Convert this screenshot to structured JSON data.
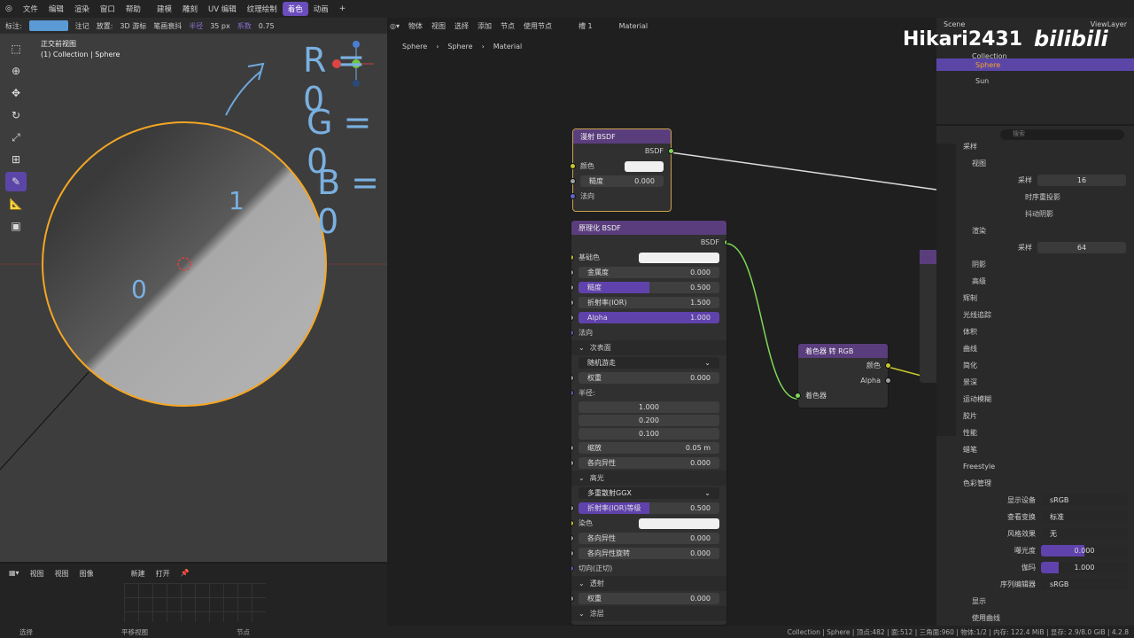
{
  "topmenu": [
    "文件",
    "编辑",
    "渲染",
    "窗口",
    "帮助"
  ],
  "workspaces": [
    "建模",
    "雕刻",
    "UV 编辑",
    "纹理绘制",
    "着色",
    "动画"
  ],
  "active_ws": "着色",
  "viewport": {
    "header_items": [
      "标注:",
      "注记",
      "放置:",
      "3D 游标",
      "笔画衰抖",
      "半径",
      "35 px",
      "系数",
      "0.75"
    ],
    "title": "正交前视图",
    "subtitle": "(1) Collection | Sphere",
    "annotations": [
      "R = 0",
      "G = 0",
      "B = 0",
      "1",
      "0"
    ]
  },
  "node_editor": {
    "header": [
      "物体",
      "视图",
      "选择",
      "添加",
      "节点",
      "使用节点",
      "槽 1",
      "Material"
    ],
    "breadcrumb": [
      "Sphere",
      "Sphere",
      "Material"
    ],
    "diffuse": {
      "title": "漫射 BSDF",
      "out": "BSDF",
      "color": "颜色",
      "rough_label": "糙度",
      "rough": "0.000",
      "normal": "法向"
    },
    "principled": {
      "title": "原理化 BSDF",
      "out": "BSDF",
      "rows": [
        {
          "l": "基础色",
          "v": "",
          "type": "color",
          "sock": "#c7c729"
        },
        {
          "l": "金属度",
          "v": "0.000",
          "type": "field",
          "fill": 0,
          "sock": "#a1a1a1"
        },
        {
          "l": "糙度",
          "v": "0.500",
          "type": "field",
          "fill": 0.5,
          "sock": "#a1a1a1"
        },
        {
          "l": "折射率(IOR)",
          "v": "1.500",
          "type": "field",
          "fill": 0,
          "sock": "#a1a1a1"
        },
        {
          "l": "Alpha",
          "v": "1.000",
          "type": "field",
          "fill": 1,
          "sock": "#a1a1a1"
        },
        {
          "l": "法向",
          "v": "",
          "type": "text",
          "sock": "#6363c7"
        }
      ],
      "subsurface": "次表面",
      "sss_method": "随机游走",
      "sss_rows": [
        {
          "l": "权重",
          "v": "0.000"
        }
      ],
      "radius_label": "半径:",
      "radius": [
        "1.000",
        "0.200",
        "0.100"
      ],
      "sss_rows2": [
        {
          "l": "缩放",
          "v": "0.05 m"
        },
        {
          "l": "各向异性",
          "v": "0.000"
        }
      ],
      "specular": "高光",
      "spec_dist": "多重散射GGX",
      "spec_rows": [
        {
          "l": "折射率(IOR)等级",
          "v": "0.500",
          "fill": 0.5
        },
        {
          "l": "染色",
          "v": "",
          "color": true
        },
        {
          "l": "各向异性",
          "v": "0.000"
        },
        {
          "l": "各向异性旋转",
          "v": "0.000"
        }
      ],
      "tangent": "切向(正切)",
      "transmission": "透射",
      "trans_rows": [
        {
          "l": "权重",
          "v": "0.000"
        }
      ],
      "cut": "涂层"
    },
    "shader_to_rgb": {
      "title": "着色器 转 RGB",
      "color": "颜色",
      "alpha": "Alpha",
      "shader": "着色器"
    }
  },
  "outliner": {
    "header": "Scene",
    "viewlayer": "ViewLayer",
    "items": [
      "Collection",
      "Sphere",
      "Sun"
    ],
    "watermark": "Hikari2431"
  },
  "properties": {
    "search": "搜索",
    "sampling": "采样",
    "viewport": "视图",
    "samples_label": "采样",
    "samples": "16",
    "temporal": "时序重投影",
    "jitter": "抖动阴影",
    "render": "渲染",
    "render_samples": "64",
    "shadows": "阴影",
    "advanced": "高级",
    "panels": [
      "辉制",
      "光线追踪",
      "体积",
      "曲线",
      "简化",
      "景深",
      "运动模糊",
      "胶片",
      "性能",
      "蜡笔",
      "Freestyle",
      "色彩管理"
    ],
    "cm": [
      {
        "l": "显示设备",
        "v": "sRGB"
      },
      {
        "l": "查看变换",
        "v": "标准"
      },
      {
        "l": "风格效果",
        "v": "无"
      },
      {
        "l": "曝光度",
        "v": "0.000"
      },
      {
        "l": "伽玛",
        "v": "1.000"
      },
      {
        "l": "序列编辑器",
        "v": "sRGB"
      }
    ],
    "display": "显示",
    "use_curves": "使用曲线"
  },
  "bottom": {
    "items": [
      "视图",
      "图像",
      "新建",
      "打开"
    ]
  },
  "status": {
    "left": "选择",
    "mid": "平移视图",
    "node": "节点",
    "right": "Collection | Sphere | 顶点:482 | 面:512 | 三角面:960 | 物体:1/2 | 内存: 122.4 MiB | 显存: 2.9/8.0 GiB | 4.2.8"
  },
  "colors": {
    "accent": "#6b4dbb",
    "orange": "#f5a623",
    "purple_head": "#5a3d7d",
    "wire_green": "#7ed957"
  }
}
